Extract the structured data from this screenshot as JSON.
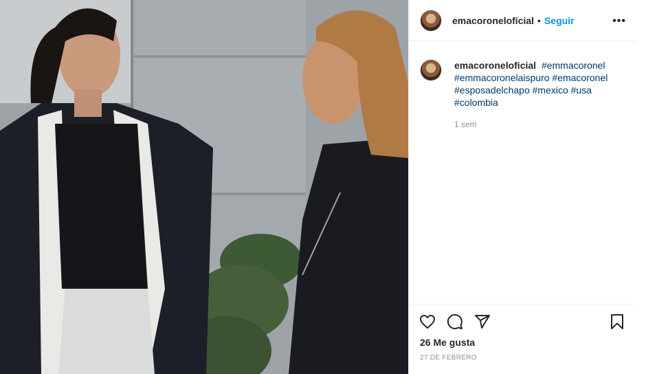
{
  "post": {
    "photo_icon": "photo-of-two-women",
    "header": {
      "username": "emacoroneloficial",
      "separator": "•",
      "follow_label": "Seguir",
      "more_icon": "more-options-icon",
      "more_label": "•••"
    },
    "caption": {
      "username": "emacoroneloficial",
      "hashtags": "#emmacoronel #emmacoronelaispuro #emacoronel #esposadelchapo #mexico #usa #colombia",
      "time": "1 sem"
    },
    "actions": {
      "like_icon": "heart-icon",
      "comment_icon": "comment-icon",
      "share_icon": "share-icon",
      "save_icon": "bookmark-icon"
    },
    "likes": "26 Me gusta",
    "date": "27 DE FEBRERO",
    "colors": {
      "link": "#00376b",
      "follow": "#0095f6",
      "muted": "#8e8e8e"
    }
  }
}
